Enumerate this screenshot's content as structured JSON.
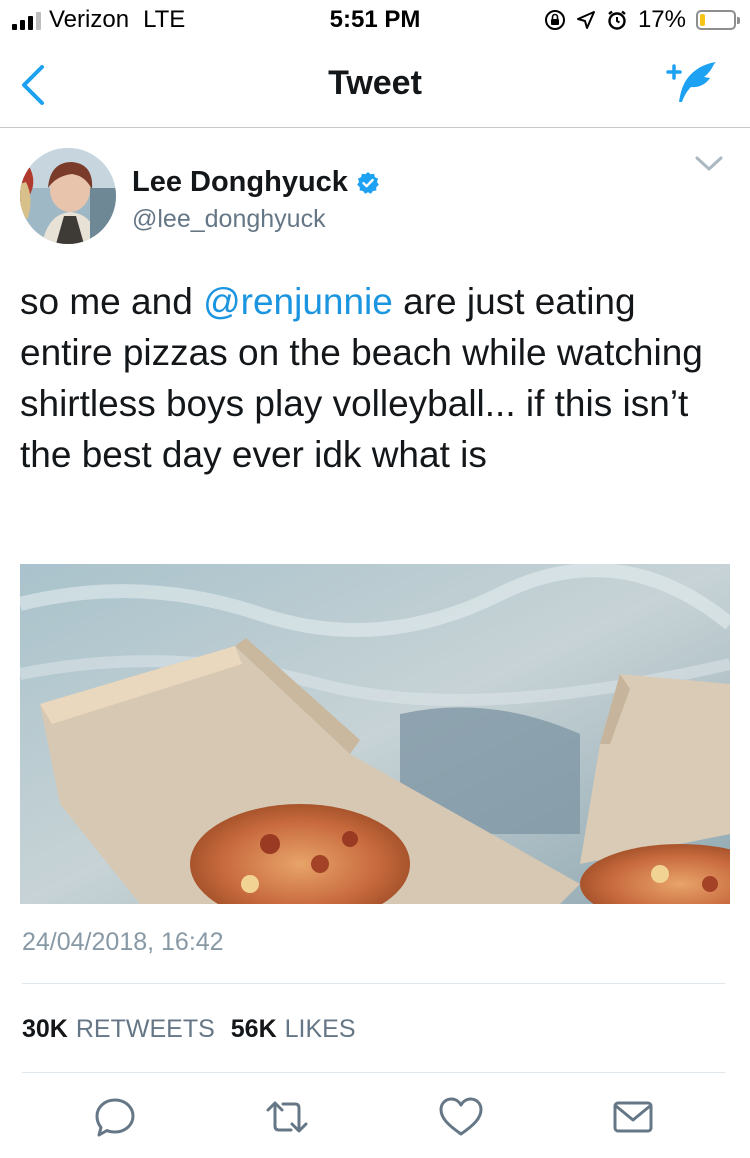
{
  "status_bar": {
    "carrier": "Verizon",
    "network": "LTE",
    "time": "5:51 PM",
    "battery_percent": "17%",
    "battery_level": 0.17,
    "battery_color": "#f5c518",
    "icons": [
      "signal-bars-icon",
      "rotation-lock-icon",
      "location-arrow-icon",
      "alarm-icon",
      "battery-icon"
    ]
  },
  "nav": {
    "title": "Tweet",
    "back_icon": "chevron-left-icon",
    "compose_icon": "compose-quill-icon",
    "accent": "#1da1f2"
  },
  "tweet": {
    "author_name": "Lee Donghyuck",
    "handle": "@lee_donghyuck",
    "verified": true,
    "text_before": "so me and ",
    "mention": "@renjunnie",
    "text_after": " are just eating entire pizzas on the beach while watching shirtless boys play volleyball... if this isn’t the best day ever idk what is",
    "media_description_icon": "photo",
    "timestamp": "24/04/2018, 16:42",
    "retweets_count": "30K",
    "retweets_label": "RETWEETS",
    "likes_count": "56K",
    "likes_label": "LIKES"
  },
  "actions": [
    "reply-icon",
    "retweet-icon",
    "like-icon",
    "direct-message-icon"
  ],
  "colors": {
    "link": "#1b95e0",
    "text_primary": "#14171a",
    "text_secondary": "#657786",
    "action_icon": "#657786"
  }
}
